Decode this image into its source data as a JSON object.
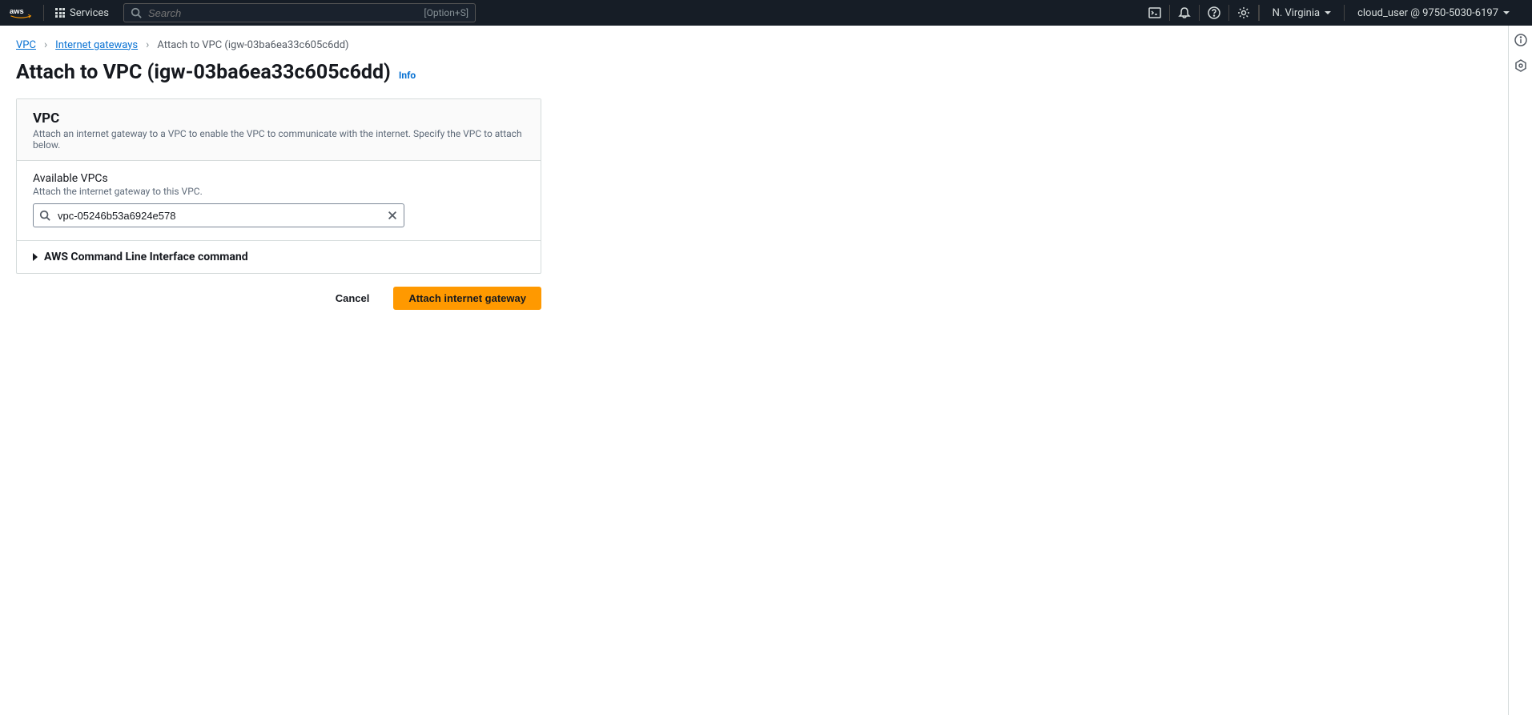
{
  "header": {
    "services_label": "Services",
    "search_placeholder": "Search",
    "search_shortcut": "[Option+S]",
    "region": "N. Virginia",
    "user": "cloud_user @ 9750-5030-6197"
  },
  "breadcrumb": {
    "items": [
      {
        "label": "VPC",
        "link": true
      },
      {
        "label": "Internet gateways",
        "link": true
      },
      {
        "label": "Attach to VPC (igw-03ba6ea33c605c6dd)",
        "link": false
      }
    ]
  },
  "page": {
    "title": "Attach to VPC (igw-03ba6ea33c605c6dd)",
    "info_label": "Info"
  },
  "panel": {
    "title": "VPC",
    "description": "Attach an internet gateway to a VPC to enable the VPC to communicate with the internet. Specify the VPC to attach below.",
    "field_label": "Available VPCs",
    "field_help": "Attach the internet gateway to this VPC.",
    "input_value": "vpc-05246b53a6924e578",
    "cli_label": "AWS Command Line Interface command"
  },
  "actions": {
    "cancel": "Cancel",
    "submit": "Attach internet gateway"
  }
}
